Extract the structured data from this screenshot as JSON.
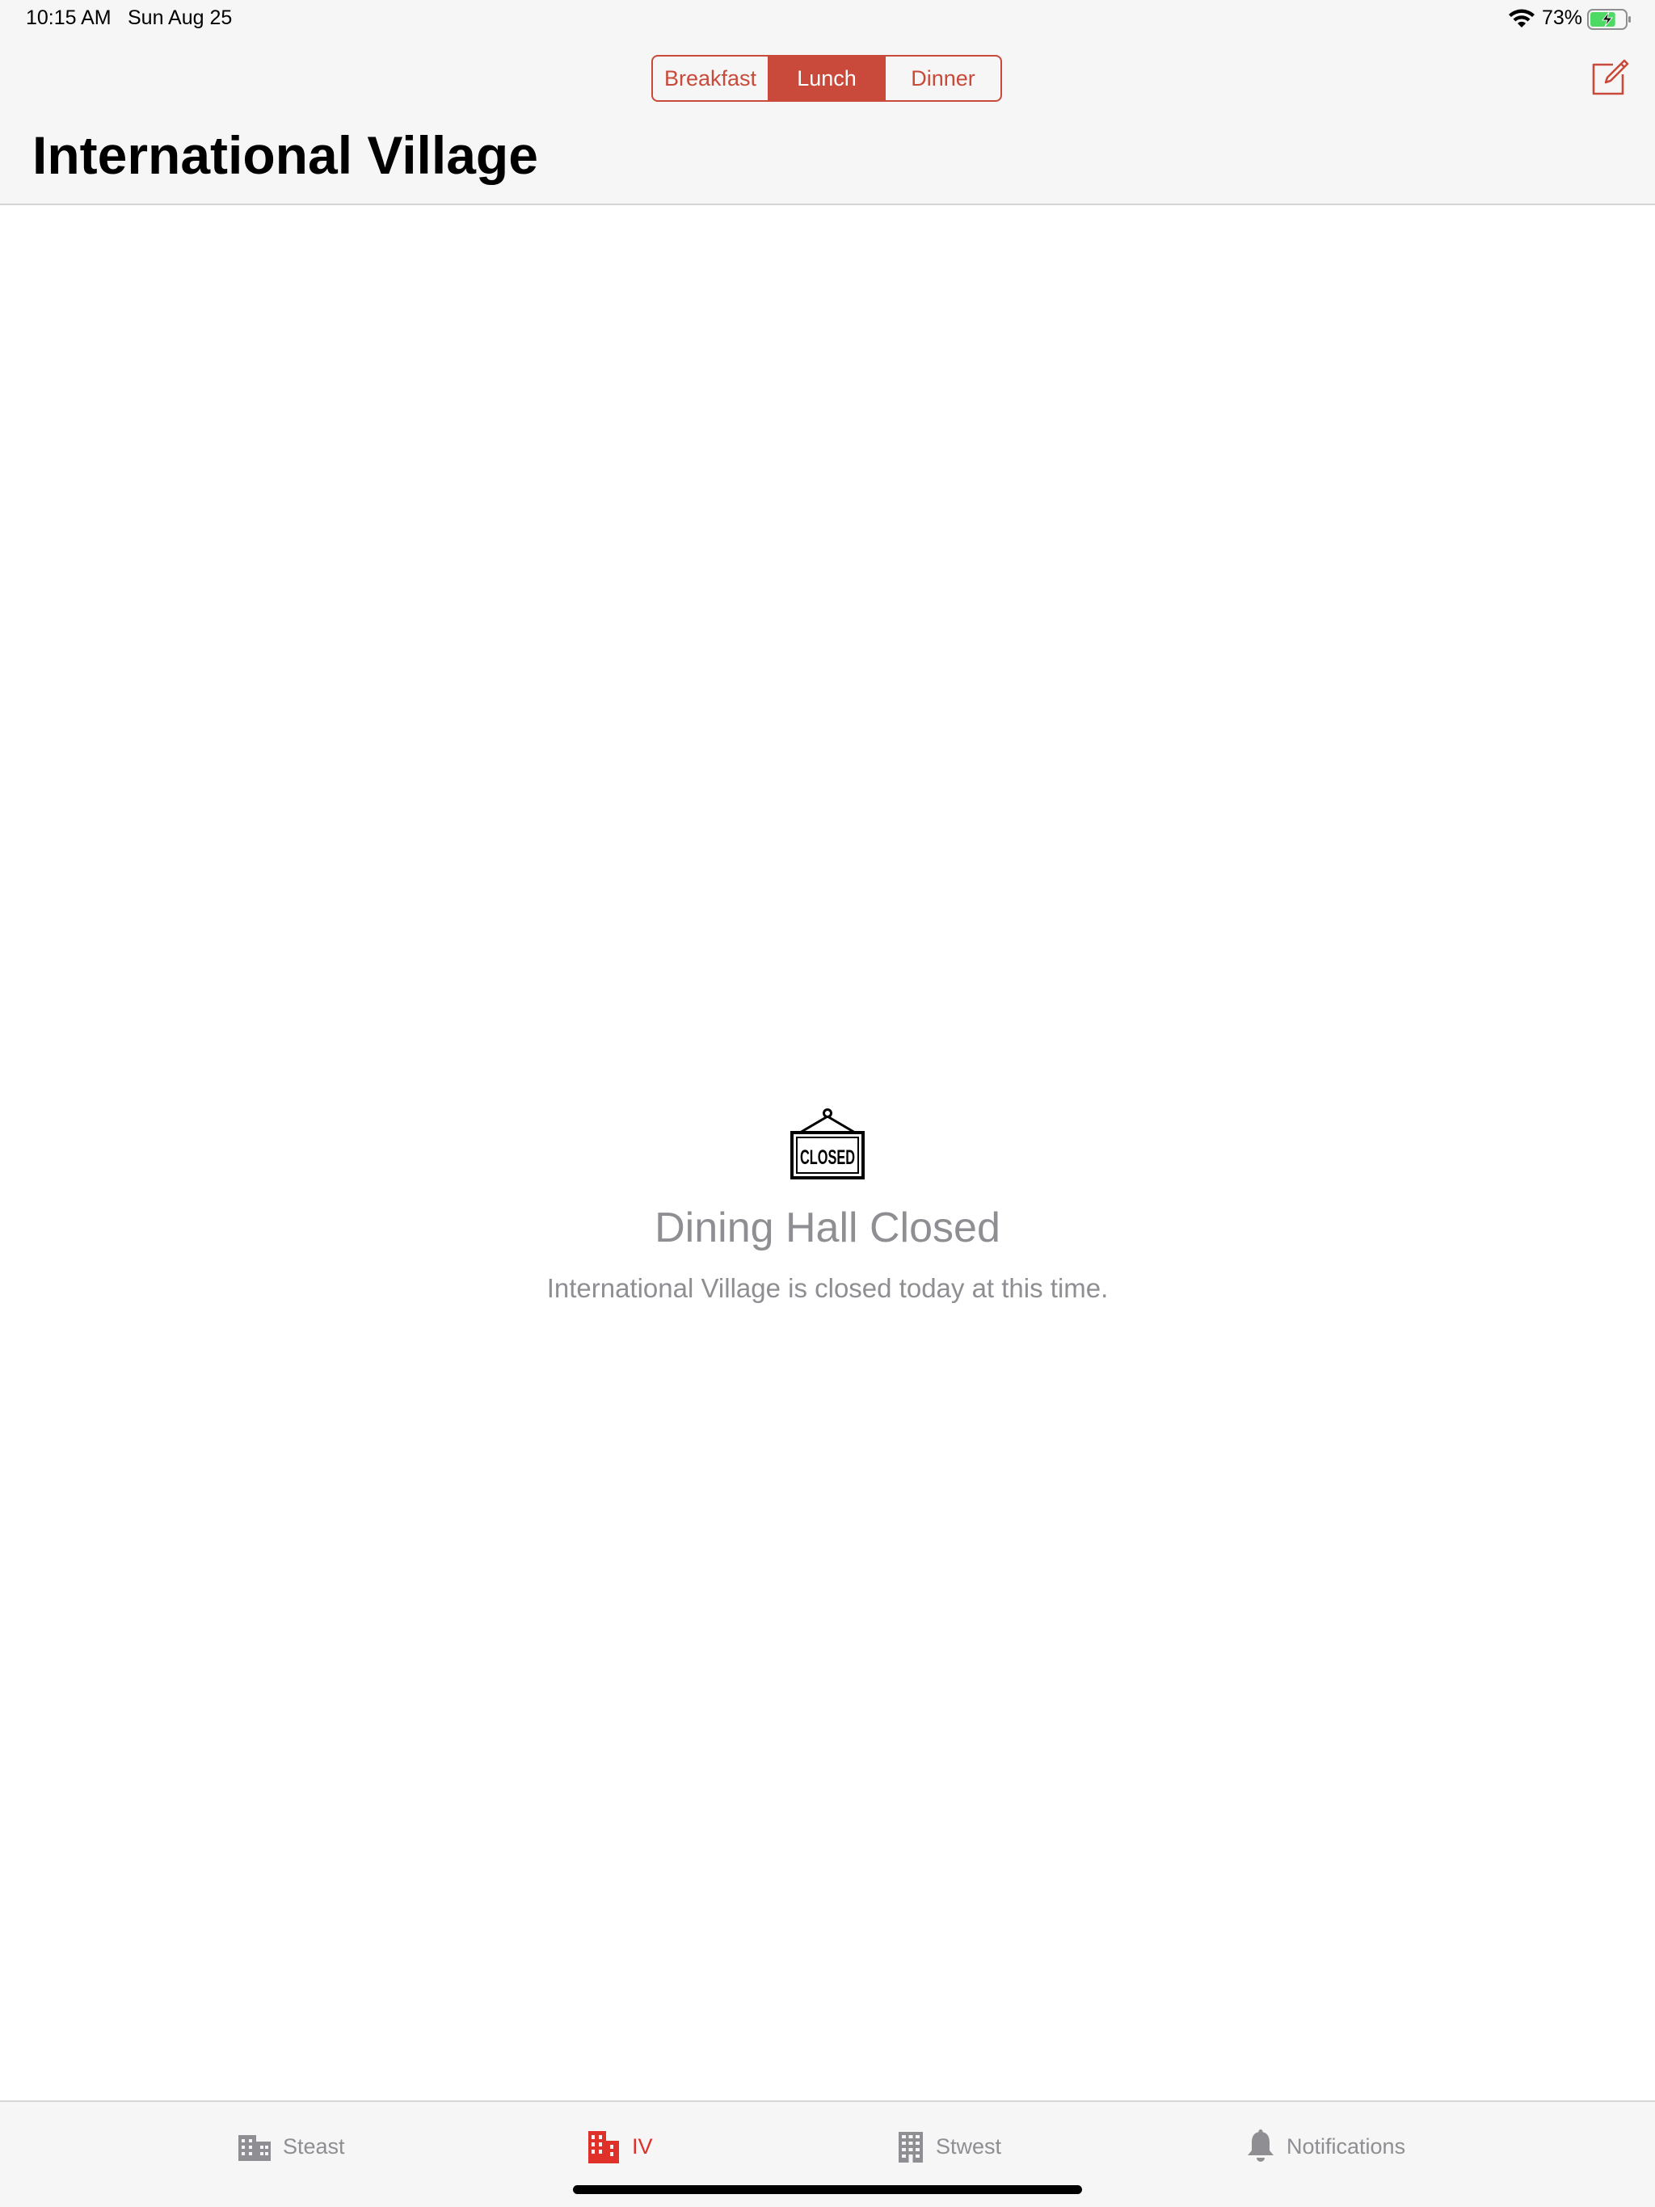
{
  "status_bar": {
    "time": "10:15 AM",
    "date": "Sun Aug 25",
    "battery_percent": "73%",
    "battery_level": 0.73,
    "charging": true,
    "icons": [
      "wifi-icon",
      "battery-charging-icon"
    ]
  },
  "header": {
    "title": "International Village",
    "compose_icon": "compose-icon",
    "meal_segments": [
      {
        "label": "Breakfast",
        "selected": false
      },
      {
        "label": "Lunch",
        "selected": true
      },
      {
        "label": "Dinner",
        "selected": false
      }
    ]
  },
  "empty_state": {
    "icon": "closed-sign-icon",
    "icon_text": "CLOSED",
    "title": "Dining Hall Closed",
    "message": "International Village is closed today at this time."
  },
  "tab_bar": {
    "tabs": [
      {
        "label": "Steast",
        "icon": "building-icon",
        "active": false
      },
      {
        "label": "IV",
        "icon": "building-icon",
        "active": true
      },
      {
        "label": "Stwest",
        "icon": "tall-building-icon",
        "active": false
      },
      {
        "label": "Notifications",
        "icon": "bell-icon",
        "active": false
      }
    ]
  },
  "colors": {
    "accent": "#c94a3a",
    "active_tab": "#e0302a",
    "inactive": "#8e8e93",
    "bar_background": "#f6f6f6"
  }
}
